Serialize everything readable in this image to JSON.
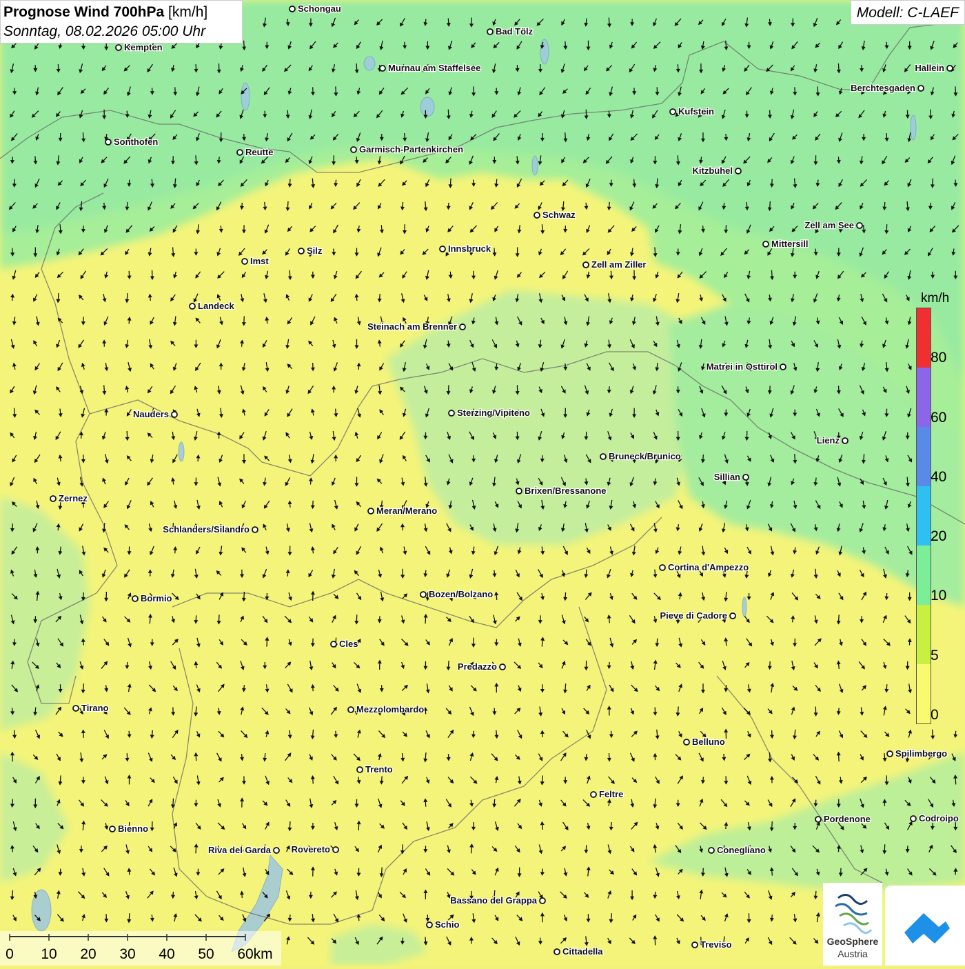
{
  "title": {
    "main": "Prognose Wind 700hPa",
    "unit": "[km/h]",
    "datetime": "Sonntag, 08.02.2026 05:00 Uhr"
  },
  "model": "Modell: C-LAEF",
  "legend": {
    "unit": "km/h",
    "labels": [
      "80",
      "60",
      "40",
      "20",
      "10",
      "5",
      "0"
    ],
    "colors": [
      "#f03030",
      "#8c66e8",
      "#5a8ae8",
      "#30c0f0",
      "#7cee98",
      "#c8f040",
      "#fafa70"
    ]
  },
  "scale": {
    "labels": [
      "0",
      "10",
      "20",
      "30",
      "40",
      "50",
      "60km"
    ]
  },
  "cities": [
    {
      "name": "Schongau"
    },
    {
      "name": "Bad Tölz"
    },
    {
      "name": "Kempten"
    },
    {
      "name": "Murnau am Staffelsee"
    },
    {
      "name": "Hallein"
    },
    {
      "name": "Berchtesgaden"
    },
    {
      "name": "Kufstein"
    },
    {
      "name": "Sonthofen"
    },
    {
      "name": "Reutte"
    },
    {
      "name": "Garmisch-Partenkirchen"
    },
    {
      "name": "Kitzbühel"
    },
    {
      "name": "Schwaz"
    },
    {
      "name": "Zell am See"
    },
    {
      "name": "Mittersill"
    },
    {
      "name": "Innsbruck"
    },
    {
      "name": "Silz"
    },
    {
      "name": "Imst"
    },
    {
      "name": "Zell am Ziller"
    },
    {
      "name": "Landeck"
    },
    {
      "name": "Steinach am Brenner"
    },
    {
      "name": "Matrei in Osttirol"
    },
    {
      "name": "Nauders"
    },
    {
      "name": "Sterzing/Vipiteno"
    },
    {
      "name": "Lienz"
    },
    {
      "name": "Bruneck/Brunico"
    },
    {
      "name": "Sillian"
    },
    {
      "name": "Brixen/Bressanone"
    },
    {
      "name": "Zernez"
    },
    {
      "name": "Meran/Merano"
    },
    {
      "name": "Schlanders/Silandro"
    },
    {
      "name": "Cortina d'Ampezzo"
    },
    {
      "name": "Bozen/Bolzano"
    },
    {
      "name": "Bormio"
    },
    {
      "name": "Pieve di Cadore"
    },
    {
      "name": "Cles"
    },
    {
      "name": "Predazzo"
    },
    {
      "name": "Tirano"
    },
    {
      "name": "Mezzolombardo"
    },
    {
      "name": "Belluno"
    },
    {
      "name": "Spilimbergo"
    },
    {
      "name": "Trento"
    },
    {
      "name": "Feltre"
    },
    {
      "name": "Bienno"
    },
    {
      "name": "Pordenone"
    },
    {
      "name": "Codroipo"
    },
    {
      "name": "Riva del Garda"
    },
    {
      "name": "Rovereto"
    },
    {
      "name": "Conegliano"
    },
    {
      "name": "Bassano del Grappa"
    },
    {
      "name": "Schio"
    },
    {
      "name": "Treviso"
    },
    {
      "name": "Cittadella"
    }
  ],
  "logos": {
    "geosphere_line1": "GeoSphere",
    "geosphere_line2": "Austria"
  }
}
